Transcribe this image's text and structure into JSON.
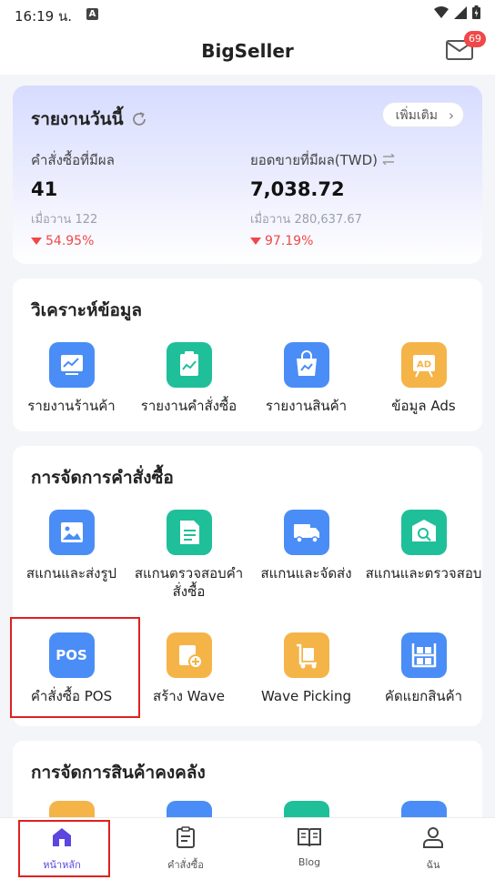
{
  "status_bar": {
    "time": "16:19 น.",
    "a_label": "A"
  },
  "app_bar": {
    "title": "BigSeller",
    "mail_badge": "69"
  },
  "report": {
    "title": "รายงานวันนี้",
    "more_label": "เพิ่มเติม",
    "orders": {
      "label": "คำสั่งซื้อที่มีผล",
      "value": "41",
      "yesterday_label": "เมื่อวาน",
      "yesterday_value": "122",
      "change": "54.95%"
    },
    "sales": {
      "label": "ยอดขายที่มีผล(TWD)",
      "value": "7,038.72",
      "yesterday_label": "เมื่อวาน",
      "yesterday_value": "280,637.67",
      "change": "97.19%"
    }
  },
  "analysis": {
    "title": "วิเคราะห์ข้อมูล",
    "items": [
      {
        "label": "รายงานร้านค้า"
      },
      {
        "label": "รายงานคำสั่งซื้อ"
      },
      {
        "label": "รายงานสินค้า"
      },
      {
        "label": "ข้อมูล Ads"
      }
    ]
  },
  "order_mgmt": {
    "title": "การจัดการคำสั่งซื้อ",
    "items": [
      {
        "label": "สแกนและส่งรูป"
      },
      {
        "label": "สแกนตรวจสอบคำสั่งซื้อ"
      },
      {
        "label": "สแกนและจัดส่ง"
      },
      {
        "label": "สแกนและตรวจสอบ"
      },
      {
        "label": "คำสั่งซื้อ POS",
        "icon_text": "POS"
      },
      {
        "label": "สร้าง Wave"
      },
      {
        "label": "Wave Picking"
      },
      {
        "label": "คัดแยกสินค้า"
      }
    ]
  },
  "inventory": {
    "title": "การจัดการสินค้าคงคลัง"
  },
  "tabs": [
    {
      "label": "หน้าหลัก"
    },
    {
      "label": "คำสั่งซื้อ"
    },
    {
      "label": "Blog"
    },
    {
      "label": "ฉัน"
    }
  ],
  "colors": {
    "accent": "#5b46e0",
    "blue": "#4a8df6",
    "green": "#1fbf9a",
    "orange": "#f4b447",
    "red": "#f04848"
  }
}
